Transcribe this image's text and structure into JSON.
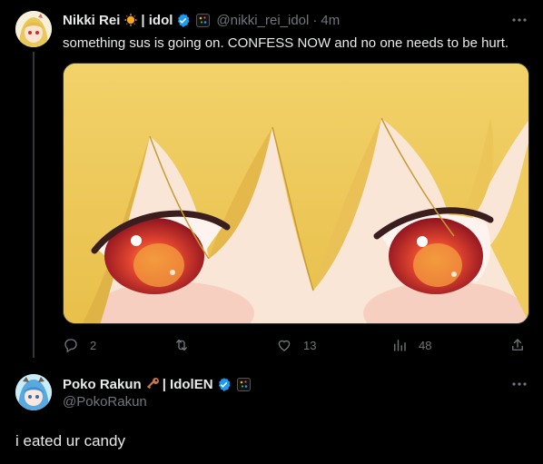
{
  "post1": {
    "author_name": "Nikki Rei",
    "author_suffix": "| idol",
    "handle": "@nikki_rei_idol",
    "dot": "·",
    "time": "4m",
    "text": "something sus is going on. CONFESS NOW and no one needs to be hurt.",
    "media_alt": "close-up anime eyes",
    "actions": {
      "reply_count": "2",
      "repost_count": "",
      "like_count": "13",
      "views_count": "48"
    }
  },
  "post2": {
    "author_name": "Poko Rakun",
    "author_suffix": "| IdolEN",
    "handle": "@PokoRakun",
    "text": "i eated ur candy"
  },
  "colors": {
    "background": "#000000",
    "text": "#e7e9ea",
    "muted": "#71767b",
    "verified": "#1d9bf0"
  },
  "icons": [
    "sun-emoji-icon",
    "verified-badge-icon",
    "affiliate-badge-icon",
    "key-emoji-icon",
    "more-icon",
    "reply-icon",
    "repost-icon",
    "like-icon",
    "views-icon",
    "share-icon"
  ]
}
